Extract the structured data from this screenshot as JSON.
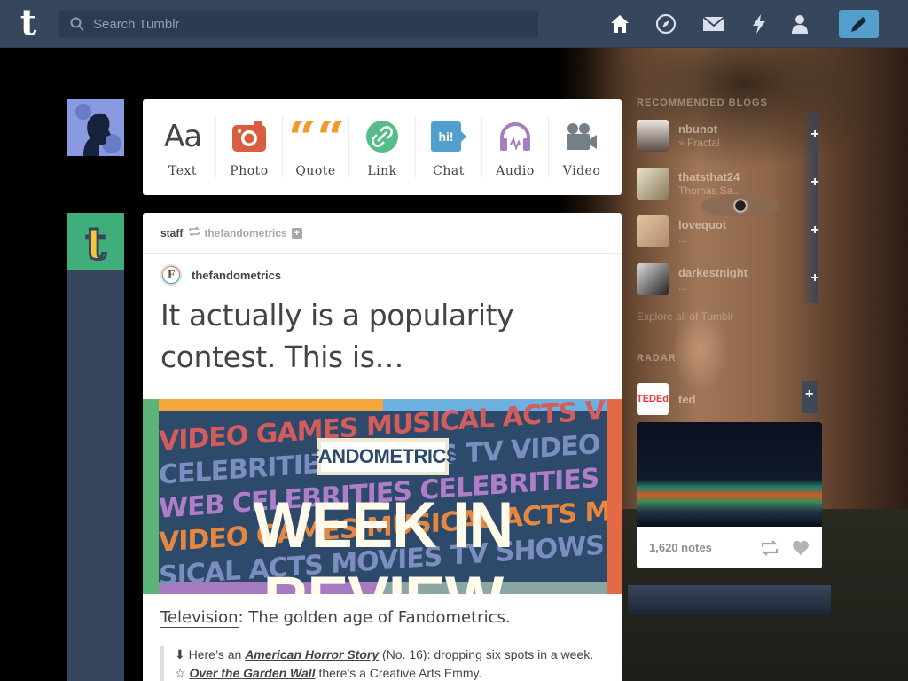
{
  "app": {
    "logo": "t"
  },
  "search": {
    "placeholder": "Search Tumblr"
  },
  "nav": {
    "icons": [
      "home-icon",
      "explore-icon",
      "inbox-icon",
      "activity-icon",
      "account-icon",
      "compose-icon"
    ]
  },
  "post_types": [
    {
      "label": "Text",
      "icon": "text-icon",
      "glyph": "Aa",
      "color": "#444444"
    },
    {
      "label": "Photo",
      "icon": "photo-icon",
      "color": "#d95e40"
    },
    {
      "label": "Quote",
      "icon": "quote-icon",
      "glyph": "““",
      "color": "#f2992e"
    },
    {
      "label": "Link",
      "icon": "link-icon",
      "color": "#56bc8a"
    },
    {
      "label": "Chat",
      "icon": "chat-icon",
      "glyph": "hi!",
      "color": "#529ecc"
    },
    {
      "label": "Audio",
      "icon": "audio-icon",
      "color": "#a77dc2"
    },
    {
      "label": "Video",
      "icon": "video-icon",
      "color": "#748089"
    }
  ],
  "post": {
    "reblogger": "staff",
    "source": "thefandometrics",
    "author": "thefandometrics",
    "author_initial": "F",
    "title": "It actually is a popularity contest. This is…",
    "banner_chip": "FANDOMETRICS",
    "banner_big": "WEEK IN REVIEW",
    "banner_words": [
      "VIDEO GAMES MUSICAL ACTS VIDEO",
      "CELEBRITIES MOVIES TV VIDEO GAMES M",
      "WEB CELEBRITIES CELEBRITIES VIDEO",
      "VIDEO GAMES MUSICAL ACTS MOVIES TV",
      "SICAL ACTS MOVIES TV SHOWS MOVIES TV SHOWS"
    ],
    "subhead_link": "Television",
    "subhead_rest": ": The golden age of Fandometrics.",
    "quote_lines": [
      {
        "prefix": "⬇ Here’s an ",
        "em": "American Horror Story",
        "rest": " (No. 16): dropping six spots in a week."
      },
      {
        "prefix": "☆ ",
        "em": "Over the Garden Wall",
        "rest": " there’s a Creative Arts Emmy."
      }
    ]
  },
  "recommended": {
    "title": "RECOMMENDED BLOGS",
    "items": [
      {
        "name": "nbunot",
        "sub": "» Fractal"
      },
      {
        "name": "thatsthat24",
        "sub": "Thomas Sa..."
      },
      {
        "name": "lovequot",
        "sub": "..."
      },
      {
        "name": "darkestnight",
        "sub": "..."
      }
    ],
    "explore": "Explore all of Tumblr"
  },
  "radar": {
    "title": "RADAR",
    "name": "ted",
    "avatar_text": "TEDEd",
    "notes": "1,620 notes"
  }
}
